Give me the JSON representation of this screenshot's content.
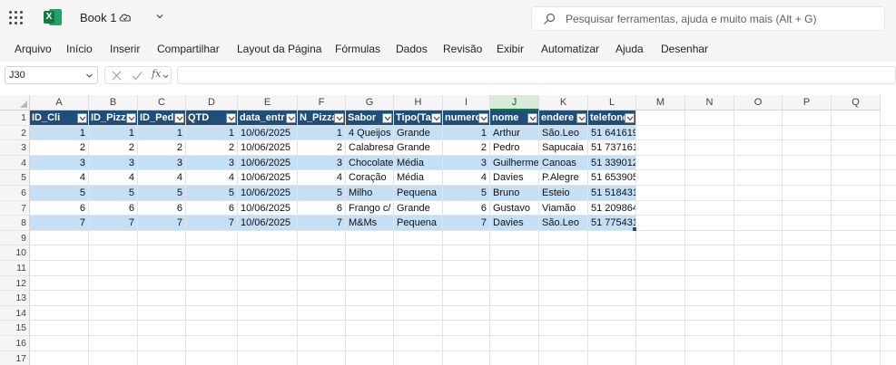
{
  "titlebar": {
    "app_icon": "excel-icon",
    "doc_title": "Book 1",
    "search_placeholder": "Pesquisar ferramentas, ajuda e muito mais (Alt + G)"
  },
  "ribbon": {
    "tabs": [
      "Arquivo",
      "Início",
      "Inserir",
      "Compartilhar",
      "Layout da Página",
      "Fórmulas",
      "Dados",
      "Revisão",
      "Exibir",
      "Automatizar",
      "Ajuda",
      "Desenhar"
    ]
  },
  "formula_bar": {
    "name_box": "J30",
    "fx_label": "fx",
    "formula": ""
  },
  "grid": {
    "columns": [
      "A",
      "B",
      "C",
      "D",
      "E",
      "F",
      "G",
      "H",
      "I",
      "J",
      "K",
      "L",
      "M",
      "N",
      "O",
      "P",
      "Q"
    ],
    "selected_column": "J",
    "row_numbers": [
      "1",
      "2",
      "3",
      "4",
      "5",
      "6",
      "7",
      "8",
      "9",
      "10",
      "11",
      "12",
      "13",
      "14",
      "15",
      "16",
      "17"
    ]
  },
  "table": {
    "header_color": "#1f4e79",
    "band_color": "#c5e0f4",
    "headers": [
      "ID_Cli",
      "ID_Pizza",
      "ID_Pedi",
      "QTD",
      "data_entr",
      "N_Pizza",
      "Sabor",
      "Tipo(Ta",
      "numero",
      "nome",
      "endere",
      "telefone"
    ],
    "rows": [
      [
        "1",
        "1",
        "1",
        "1",
        "10/06/2025",
        "1",
        "4 Queijos",
        "Grande",
        "1",
        "Arthur",
        "São.Leo",
        "51 641619"
      ],
      [
        "2",
        "2",
        "2",
        "2",
        "10/06/2025",
        "2",
        "Calabresa",
        "Grande",
        "2",
        "Pedro",
        "Sapucaia",
        "51 737161"
      ],
      [
        "3",
        "3",
        "3",
        "3",
        "10/06/2025",
        "3",
        "Chocolate",
        "Média",
        "3",
        "Guilherme",
        "Canoas",
        "51 339012"
      ],
      [
        "4",
        "4",
        "4",
        "4",
        "10/06/2025",
        "4",
        "Coração",
        "Média",
        "4",
        "Davies",
        "P.Alegre",
        "51 653905"
      ],
      [
        "5",
        "5",
        "5",
        "5",
        "10/06/2025",
        "5",
        "Milho",
        "Pequena",
        "5",
        "Bruno",
        "Esteio",
        "51 518431"
      ],
      [
        "6",
        "6",
        "6",
        "6",
        "10/06/2025",
        "6",
        "Frango c/ c",
        "Grande",
        "6",
        "Gustavo",
        "Viamão",
        "51 209864"
      ],
      [
        "7",
        "7",
        "7",
        "7",
        "10/06/2025",
        "7",
        "M&Ms",
        "Pequena",
        "7",
        "Davies",
        "São.Leo",
        "51 775431"
      ]
    ],
    "column_types": [
      "num",
      "num",
      "num",
      "num",
      "txt",
      "num",
      "txt",
      "txt",
      "num",
      "txt",
      "txt",
      "txt"
    ]
  }
}
